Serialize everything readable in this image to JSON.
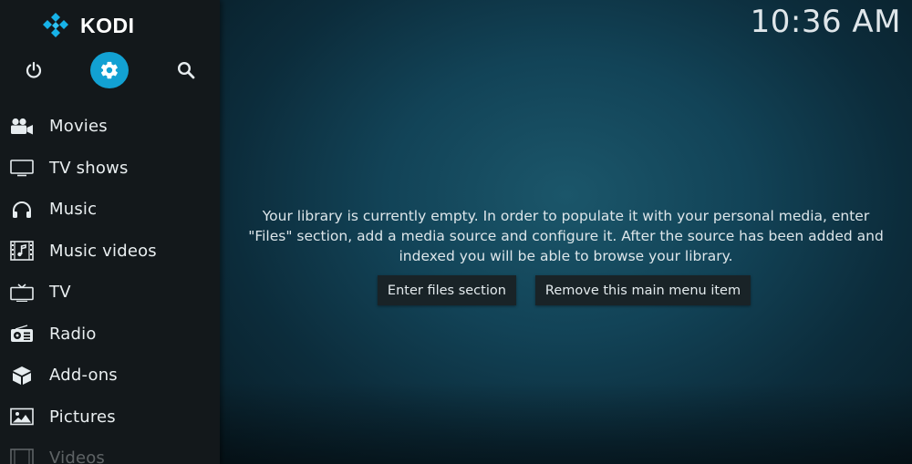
{
  "app": {
    "name": "KODI",
    "clock": "10:36 AM",
    "colors": {
      "accent": "#12a1d3",
      "sidebar": "#13181b",
      "background": "#124357"
    }
  },
  "top_buttons": [
    {
      "name": "power",
      "icon": "power-icon"
    },
    {
      "name": "settings",
      "icon": "gear-icon",
      "active": true
    },
    {
      "name": "search",
      "icon": "search-icon"
    }
  ],
  "menu": {
    "items": [
      {
        "label": "Movies",
        "icon": "movie-camera-icon"
      },
      {
        "label": "TV shows",
        "icon": "monitor-icon"
      },
      {
        "label": "Music",
        "icon": "headphones-icon"
      },
      {
        "label": "Music videos",
        "icon": "film-music-icon"
      },
      {
        "label": "TV",
        "icon": "tv-icon"
      },
      {
        "label": "Radio",
        "icon": "radio-icon"
      },
      {
        "label": "Add-ons",
        "icon": "box-icon"
      },
      {
        "label": "Pictures",
        "icon": "picture-icon"
      },
      {
        "label": "Videos",
        "icon": "film-icon"
      }
    ]
  },
  "library": {
    "message_lines": [
      "Your library is currently empty. In order to populate it with your personal media, enter",
      "\"Files\" section, add a media source and configure it. After the source has been added and",
      "indexed you will be able to browse your library."
    ],
    "enter_files_label": "Enter files section",
    "remove_item_label": "Remove this main menu item"
  }
}
